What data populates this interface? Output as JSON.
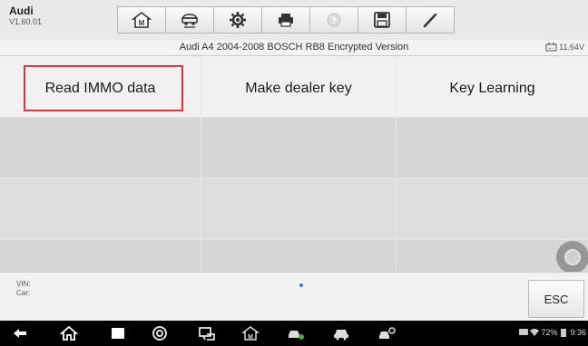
{
  "header": {
    "brand": "Audi",
    "version": "V1.60.01"
  },
  "toolbar": {
    "buttons": [
      {
        "name": "home-button",
        "icon": "home-icon"
      },
      {
        "name": "vehicle-swap-button",
        "icon": "vehicle-swap-icon"
      },
      {
        "name": "settings-button",
        "icon": "gear-icon"
      },
      {
        "name": "print-button",
        "icon": "printer-icon"
      },
      {
        "name": "help-button",
        "icon": "help-icon"
      },
      {
        "name": "save-button",
        "icon": "floppy-icon"
      },
      {
        "name": "edit-button",
        "icon": "pen-icon"
      }
    ]
  },
  "title_bar": {
    "title": "Audi A4 2004-2008 BOSCH RB8 Encrypted Version",
    "battery_voltage": "11.64V"
  },
  "menu": {
    "items": [
      "Read IMMO data",
      "Make dealer key",
      "Key Learning"
    ],
    "highlight_color": "#d8343b"
  },
  "info_bar": {
    "vin_label": "VIN:",
    "car_label": "Car:",
    "esc_label": "ESC"
  },
  "system_bar": {
    "icons": [
      "back-icon",
      "home-icon",
      "recents-icon",
      "chrome-icon",
      "screen-cast-icon",
      "maxisys-home-icon",
      "car-service-icon",
      "car-icon",
      "car-settings-icon"
    ],
    "battery_percent": "72%",
    "time": "9:36"
  }
}
